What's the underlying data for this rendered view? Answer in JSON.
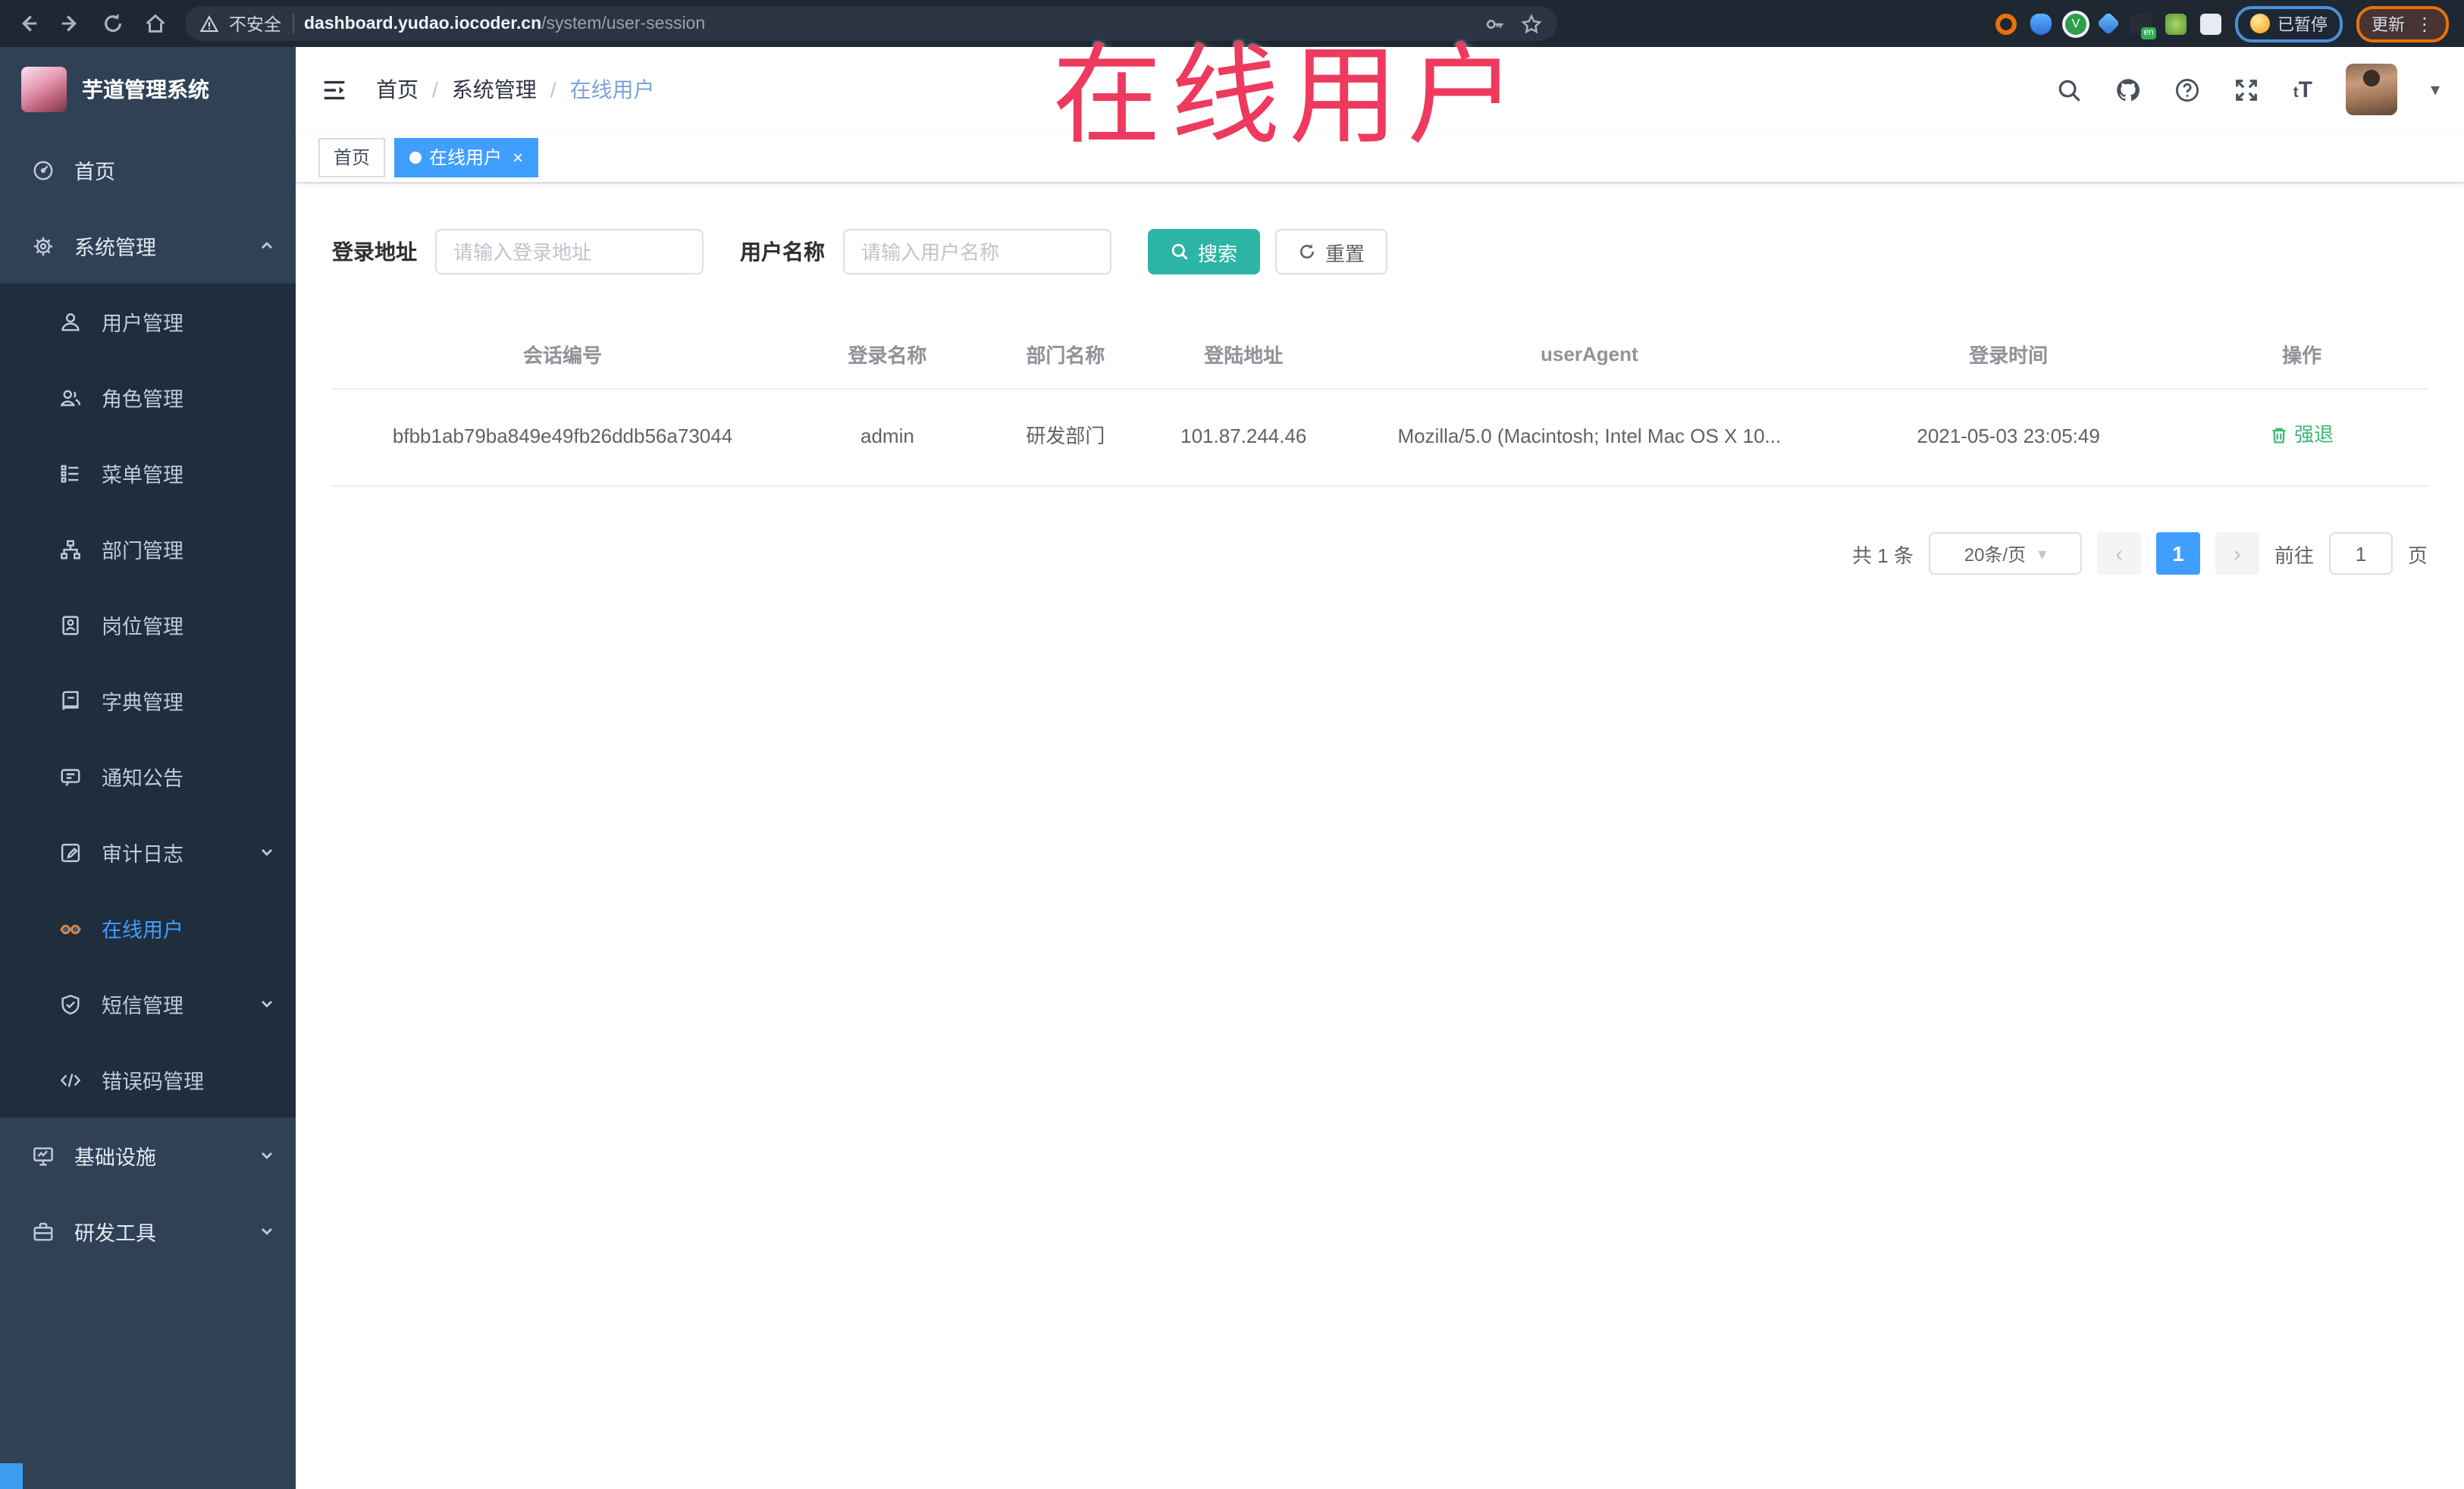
{
  "browser": {
    "security_label": "不安全",
    "url_host": "dashboard.yudao.iocoder.cn",
    "url_path": "/system/user-session",
    "paused_badge_label": "已暂停",
    "update_button_label": "更新"
  },
  "overlay": {
    "text": "在线用户"
  },
  "sidebar": {
    "logo_title": "芋道管理系统",
    "items": [
      {
        "label": "首页",
        "icon": "dashboard-icon"
      },
      {
        "label": "系统管理",
        "icon": "gear-icon",
        "state": "expanded"
      },
      {
        "label": "用户管理",
        "icon": "user-icon"
      },
      {
        "label": "角色管理",
        "icon": "roles-icon"
      },
      {
        "label": "菜单管理",
        "icon": "menu-list-icon"
      },
      {
        "label": "部门管理",
        "icon": "org-tree-icon"
      },
      {
        "label": "岗位管理",
        "icon": "id-badge-icon"
      },
      {
        "label": "字典管理",
        "icon": "dictionary-icon"
      },
      {
        "label": "通知公告",
        "icon": "announcement-icon"
      },
      {
        "label": "审计日志",
        "icon": "audit-log-icon",
        "state": "collapsed"
      },
      {
        "label": "在线用户",
        "icon": "goggles-icon",
        "state": "active"
      },
      {
        "label": "短信管理",
        "icon": "shield-check-icon",
        "state": "collapsed"
      },
      {
        "label": "错误码管理",
        "icon": "code-icon"
      },
      {
        "label": "基础设施",
        "icon": "monitor-icon",
        "state": "collapsed"
      },
      {
        "label": "研发工具",
        "icon": "toolbox-icon",
        "state": "collapsed"
      }
    ]
  },
  "header": {
    "breadcrumb": [
      "首页",
      "系统管理",
      "在线用户"
    ]
  },
  "tags": [
    {
      "label": "首页",
      "active": false
    },
    {
      "label": "在线用户",
      "active": true
    }
  ],
  "filters": {
    "address_label": "登录地址",
    "address_placeholder": "请输入登录地址",
    "name_label": "用户名称",
    "name_placeholder": "请输入用户名称",
    "search_label": "搜索",
    "reset_label": "重置"
  },
  "table": {
    "headers": [
      "会话编号",
      "登录名称",
      "部门名称",
      "登陆地址",
      "userAgent",
      "登录时间",
      "操作"
    ],
    "rows": [
      {
        "session_id": "bfbb1ab79ba849e49fb26ddb56a73044",
        "login_name": "admin",
        "dept_name": "研发部门",
        "login_ip": "101.87.244.46",
        "user_agent": "Mozilla/5.0 (Macintosh; Intel Mac OS X 10...",
        "login_time": "2021-05-03 23:05:49",
        "action_label": "强退"
      }
    ]
  },
  "pagination": {
    "total_label": "共 1 条",
    "page_size_label": "20条/页",
    "current_page": "1",
    "goto_label": "前往",
    "goto_value": "1",
    "unit_label": "页"
  },
  "icons": {
    "slash": "/",
    "close": "×",
    "prev": "‹",
    "next": "›",
    "caret_down": "▾",
    "kebab": "⋮",
    "font_size": "tT"
  },
  "colors": {
    "accent": "#409eff",
    "search_button": "#2cb5a5",
    "action_link": "#3db873",
    "overlay_text": "#ee3a5e",
    "sidebar_bg": "#304156",
    "submenu_bg": "#1f2d3d"
  }
}
